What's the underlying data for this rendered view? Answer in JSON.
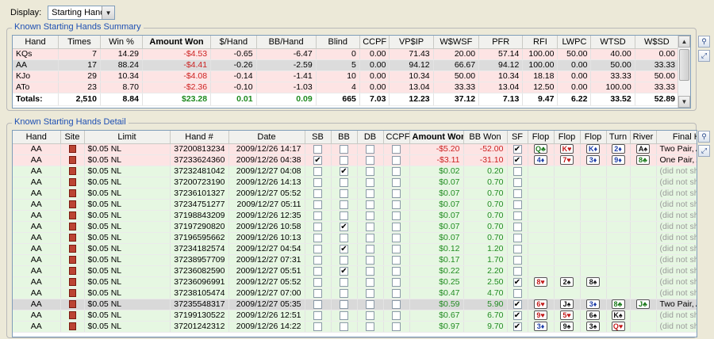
{
  "display": {
    "label": "Display:",
    "value": "Starting Hands"
  },
  "summary": {
    "title": "Known Starting Hands Summary",
    "columns": [
      "Hand",
      "Times",
      "Win %",
      "Amount Won",
      "$/Hand",
      "BB/Hand",
      "Blind",
      "CCPF",
      "VP$IP",
      "W$WSF",
      "PFR",
      "RFI",
      "LWPC",
      "WTSD",
      "W$SD"
    ],
    "rows": [
      {
        "cells": [
          "KQs",
          "7",
          "14.29",
          "-$4.53",
          "-0.65",
          "-6.47",
          "0",
          "0.00",
          "71.43",
          "20.00",
          "57.14",
          "100.00",
          "50.00",
          "40.00",
          "0.00"
        ],
        "style": "pink"
      },
      {
        "cells": [
          "AA",
          "17",
          "88.24",
          "-$4.41",
          "-0.26",
          "-2.59",
          "5",
          "0.00",
          "94.12",
          "66.67",
          "94.12",
          "100.00",
          "0.00",
          "50.00",
          "33.33"
        ],
        "style": "sel"
      },
      {
        "cells": [
          "KJo",
          "29",
          "10.34",
          "-$4.08",
          "-0.14",
          "-1.41",
          "10",
          "0.00",
          "10.34",
          "50.00",
          "10.34",
          "18.18",
          "0.00",
          "33.33",
          "50.00"
        ],
        "style": "pink"
      },
      {
        "cells": [
          "ATo",
          "23",
          "8.70",
          "-$2.36",
          "-0.10",
          "-1.03",
          "4",
          "0.00",
          "13.04",
          "33.33",
          "13.04",
          "12.50",
          "0.00",
          "100.00",
          "33.33"
        ],
        "style": "pink"
      }
    ],
    "totals": [
      "Totals:",
      "2,510",
      "8.84",
      "$23.28",
      "0.01",
      "0.09",
      "665",
      "7.03",
      "12.23",
      "37.12",
      "7.13",
      "9.47",
      "6.22",
      "33.52",
      "52.89"
    ]
  },
  "detail": {
    "title": "Known Starting Hands Detail",
    "columns": [
      "Hand",
      "Site",
      "Limit",
      "Hand #",
      "Date",
      "SB",
      "BB",
      "DB",
      "CCPF",
      "Amount Won",
      "BB Won",
      "SF",
      "Flop",
      "Flop",
      "Flop",
      "Turn",
      "River",
      "Final Hand"
    ],
    "rows": [
      {
        "hand": "AA",
        "limit": "$0.05 NL",
        "handno": "37200813234",
        "date": "2009/12/26 14:17",
        "sb": false,
        "bb": false,
        "db": false,
        "ccpf": false,
        "amount": "-$5.20",
        "bbwon": "-52.00",
        "sf": true,
        "cards": [
          {
            "t": "Q♣",
            "c": "grn"
          },
          {
            "t": "K♥",
            "c": "red"
          },
          {
            "t": "K♦",
            "c": "blu"
          },
          {
            "t": "2♦",
            "c": "blu"
          },
          {
            "t": "A♠",
            "c": "blk"
          }
        ],
        "final": "Two Pair, Aces and Kings",
        "style": "pink"
      },
      {
        "hand": "AA",
        "limit": "$0.05 NL",
        "handno": "37233624360",
        "date": "2009/12/26 04:38",
        "sb": true,
        "bb": false,
        "db": false,
        "ccpf": false,
        "amount": "-$3.11",
        "bbwon": "-31.10",
        "sf": true,
        "cards": [
          {
            "t": "4♦",
            "c": "blu"
          },
          {
            "t": "7♥",
            "c": "red"
          },
          {
            "t": "3♦",
            "c": "blu"
          },
          {
            "t": "9♦",
            "c": "blu"
          },
          {
            "t": "8♣",
            "c": "grn"
          }
        ],
        "final": "One Pair, Aces",
        "style": "pink"
      },
      {
        "hand": "AA",
        "limit": "$0.05 NL",
        "handno": "37232481042",
        "date": "2009/12/27 04:08",
        "sb": false,
        "bb": true,
        "db": false,
        "ccpf": false,
        "amount": "$0.02",
        "bbwon": "0.20",
        "sf": false,
        "cards": [],
        "final": "(did not show hand)",
        "style": "green"
      },
      {
        "hand": "AA",
        "limit": "$0.05 NL",
        "handno": "37200723190",
        "date": "2009/12/26 14:13",
        "sb": false,
        "bb": false,
        "db": false,
        "ccpf": false,
        "amount": "$0.07",
        "bbwon": "0.70",
        "sf": false,
        "cards": [],
        "final": "(did not show hand)",
        "style": "green"
      },
      {
        "hand": "AA",
        "limit": "$0.05 NL",
        "handno": "37236101327",
        "date": "2009/12/27 05:52",
        "sb": false,
        "bb": false,
        "db": false,
        "ccpf": false,
        "amount": "$0.07",
        "bbwon": "0.70",
        "sf": false,
        "cards": [],
        "final": "(did not show hand)",
        "style": "green"
      },
      {
        "hand": "AA",
        "limit": "$0.05 NL",
        "handno": "37234751277",
        "date": "2009/12/27 05:11",
        "sb": false,
        "bb": false,
        "db": false,
        "ccpf": false,
        "amount": "$0.07",
        "bbwon": "0.70",
        "sf": false,
        "cards": [],
        "final": "(did not show hand)",
        "style": "green"
      },
      {
        "hand": "AA",
        "limit": "$0.05 NL",
        "handno": "37198843209",
        "date": "2009/12/26 12:35",
        "sb": false,
        "bb": false,
        "db": false,
        "ccpf": false,
        "amount": "$0.07",
        "bbwon": "0.70",
        "sf": false,
        "cards": [],
        "final": "(did not show hand)",
        "style": "green"
      },
      {
        "hand": "AA",
        "limit": "$0.05 NL",
        "handno": "37197290820",
        "date": "2009/12/26 10:58",
        "sb": false,
        "bb": true,
        "db": false,
        "ccpf": false,
        "amount": "$0.07",
        "bbwon": "0.70",
        "sf": false,
        "cards": [],
        "final": "(did not show hand)",
        "style": "green"
      },
      {
        "hand": "AA",
        "limit": "$0.05 NL",
        "handno": "37196595662",
        "date": "2009/12/26 10:13",
        "sb": false,
        "bb": false,
        "db": false,
        "ccpf": false,
        "amount": "$0.07",
        "bbwon": "0.70",
        "sf": false,
        "cards": [],
        "final": "(did not show hand)",
        "style": "green"
      },
      {
        "hand": "AA",
        "limit": "$0.05 NL",
        "handno": "37234182574",
        "date": "2009/12/27 04:54",
        "sb": false,
        "bb": true,
        "db": false,
        "ccpf": false,
        "amount": "$0.12",
        "bbwon": "1.20",
        "sf": false,
        "cards": [],
        "final": "(did not show hand)",
        "style": "green"
      },
      {
        "hand": "AA",
        "limit": "$0.05 NL",
        "handno": "37238957709",
        "date": "2009/12/27 07:31",
        "sb": false,
        "bb": false,
        "db": false,
        "ccpf": false,
        "amount": "$0.17",
        "bbwon": "1.70",
        "sf": false,
        "cards": [],
        "final": "(did not show hand)",
        "style": "green"
      },
      {
        "hand": "AA",
        "limit": "$0.05 NL",
        "handno": "37236082590",
        "date": "2009/12/27 05:51",
        "sb": false,
        "bb": true,
        "db": false,
        "ccpf": false,
        "amount": "$0.22",
        "bbwon": "2.20",
        "sf": false,
        "cards": [],
        "final": "(did not show hand)",
        "style": "green"
      },
      {
        "hand": "AA",
        "limit": "$0.05 NL",
        "handno": "37236096991",
        "date": "2009/12/27 05:52",
        "sb": false,
        "bb": false,
        "db": false,
        "ccpf": false,
        "amount": "$0.25",
        "bbwon": "2.50",
        "sf": true,
        "cards": [
          {
            "t": "8♥",
            "c": "red"
          },
          {
            "t": "2♠",
            "c": "blk"
          },
          {
            "t": "8♠",
            "c": "blk"
          }
        ],
        "final": "(did not show hand)",
        "style": "green"
      },
      {
        "hand": "AA",
        "limit": "$0.05 NL",
        "handno": "37238105474",
        "date": "2009/12/27 07:00",
        "sb": false,
        "bb": false,
        "db": false,
        "ccpf": false,
        "amount": "$0.47",
        "bbwon": "4.70",
        "sf": false,
        "cards": [],
        "final": "(did not show hand)",
        "style": "green"
      },
      {
        "hand": "AA",
        "limit": "$0.05 NL",
        "handno": "37235548317",
        "date": "2009/12/27 05:35",
        "sb": false,
        "bb": false,
        "db": false,
        "ccpf": false,
        "amount": "$0.59",
        "bbwon": "5.90",
        "sf": true,
        "cards": [
          {
            "t": "6♥",
            "c": "red"
          },
          {
            "t": "J♠",
            "c": "blk"
          },
          {
            "t": "3♦",
            "c": "blu"
          },
          {
            "t": "8♣",
            "c": "grn"
          },
          {
            "t": "J♣",
            "c": "grn"
          }
        ],
        "final": "Two Pair, Aces and Jacks",
        "style": "gray"
      },
      {
        "hand": "AA",
        "limit": "$0.05 NL",
        "handno": "37199130522",
        "date": "2009/12/26 12:51",
        "sb": false,
        "bb": false,
        "db": false,
        "ccpf": false,
        "amount": "$0.67",
        "bbwon": "6.70",
        "sf": true,
        "cards": [
          {
            "t": "9♥",
            "c": "red"
          },
          {
            "t": "5♥",
            "c": "red"
          },
          {
            "t": "6♠",
            "c": "blk"
          },
          {
            "t": "K♠",
            "c": "blk"
          }
        ],
        "final": "(did not show hand)",
        "style": "green"
      },
      {
        "hand": "AA",
        "limit": "$0.05 NL",
        "handno": "37201242312",
        "date": "2009/12/26 14:22",
        "sb": false,
        "bb": false,
        "db": false,
        "ccpf": false,
        "amount": "$0.97",
        "bbwon": "9.70",
        "sf": true,
        "cards": [
          {
            "t": "3♦",
            "c": "blu"
          },
          {
            "t": "9♠",
            "c": "blk"
          },
          {
            "t": "3♠",
            "c": "blk"
          },
          {
            "t": "Q♥",
            "c": "red"
          }
        ],
        "final": "(did not show hand)",
        "style": "green"
      }
    ]
  },
  "colors": {
    "negative": "#cc2222",
    "positive": "#228b22",
    "title": "#1e4fb3",
    "loss_row": "#fde4e4",
    "win_row": "#e6f7e2"
  },
  "icons": [
    "chevron-down-icon",
    "filter-icon",
    "expand-icon",
    "scroll-up-icon",
    "scroll-down-icon",
    "site-logo-icon"
  ]
}
